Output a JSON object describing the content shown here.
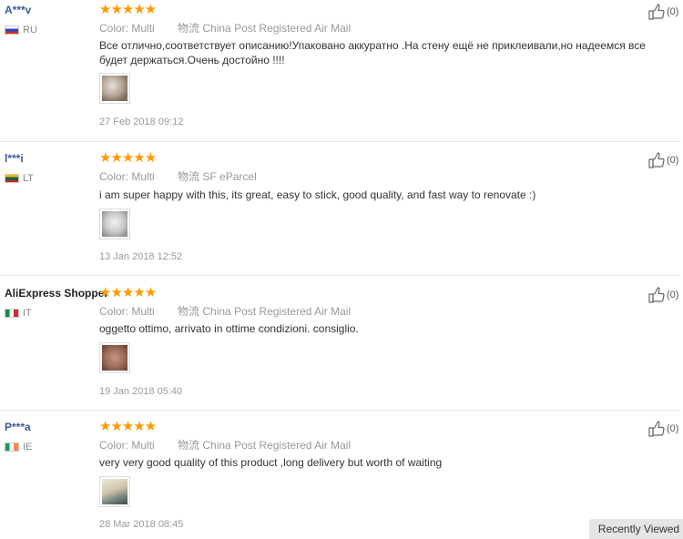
{
  "reviews": [
    {
      "buyer": "A***v",
      "country": "RU",
      "stars": "★★★★★",
      "color_label": "Color:",
      "color_value": "Multi",
      "shipping": "物流 China Post Registered Air Mail",
      "text": "Все отлично,соответствует описанию!Упаковано аккуратно .На стену ещё не приклеивали,но надеемся все будет держаться.Очень достойно !!!!",
      "date": "27 Feb 2018 09:12",
      "helpful_count": "(0)"
    },
    {
      "buyer": "l***i",
      "country": "LT",
      "stars": "★★★★★",
      "color_label": "Color:",
      "color_value": "Multi",
      "shipping": "物流 SF eParcel",
      "text": "i am super happy with this, its great, easy to stick, good quality, and fast way to renovate :)",
      "date": "13 Jan 2018 12:52",
      "helpful_count": "(0)"
    },
    {
      "buyer": "AliExpress Shopper",
      "country": "IT",
      "stars": "★★★★★",
      "color_label": "Color:",
      "color_value": "Multi",
      "shipping": "物流 China Post Registered Air Mail",
      "text": "oggetto ottimo, arrivato in ottime condizioni. consiglio.",
      "date": "19 Jan 2018 05:40",
      "helpful_count": "(0)"
    },
    {
      "buyer": "P***a",
      "country": "IE",
      "stars": "★★★★★",
      "color_label": "Color:",
      "color_value": "Multi",
      "shipping": "物流 China Post Registered Air Mail",
      "text": "very very good quality of this product ,long delivery but worth of waiting",
      "date": "28 Mar 2018 08:45",
      "helpful_count": "(0)"
    }
  ],
  "recently_viewed": "Recently Viewed",
  "colors": {
    "star": "#ff9900",
    "buyer_link": "#3b5998",
    "muted": "#999999"
  }
}
